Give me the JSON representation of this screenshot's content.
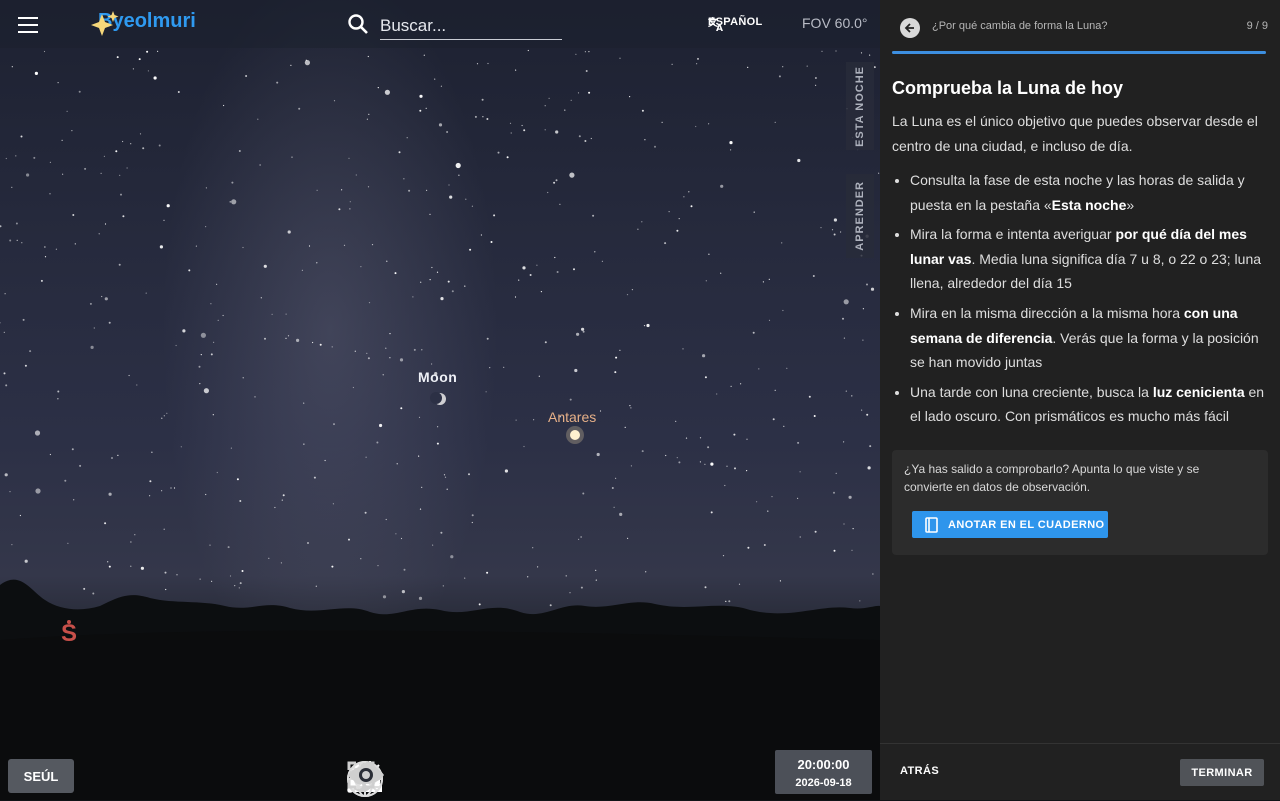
{
  "app": {
    "name": "Byeolmuri"
  },
  "search": {
    "placeholder": "Buscar..."
  },
  "language": {
    "label": "ESPAÑOL"
  },
  "fov": {
    "label": "FOV 60.0°"
  },
  "side_tabs": {
    "tonight": "ESTA NOCHE",
    "learn": "APRENDER"
  },
  "sky": {
    "labels": {
      "moon": "Moon",
      "antares": "Antares"
    },
    "compass": "S"
  },
  "location": {
    "label": "SEÚL"
  },
  "toolbar": {
    "icons": [
      "constellation-lines-icon",
      "constellation-art-icon",
      "atmosphere-icon",
      "landscape-icon",
      "azimuthal-grid-icon",
      "equatorial-grid-icon",
      "deep-sky-objects-icon",
      "night-mode-eye-icon",
      "fullscreen-icon"
    ]
  },
  "datetime": {
    "time": "20:00:00",
    "date": "2026-09-18"
  },
  "panel": {
    "breadcrumb": "¿Por qué cambia de forma la Luna?",
    "step_counter": "9 / 9",
    "progress": 1.0,
    "title": "Comprueba la Luna de hoy",
    "intro": "La Luna es el único objetivo que puedes observar desde el centro de una ciudad, e incluso de día.",
    "bullets": [
      {
        "a": "Consulta la fase de esta noche y las horas de salida y puesta en la pestaña «",
        "b": "Esta noche",
        "c": "»",
        "d": "",
        "e": ""
      },
      {
        "a": "Mira la forma e intenta averiguar ",
        "b": "por qué día del mes lunar vas",
        "c": ". Media luna significa día 7 u 8, o 22 o 23; luna llena, alrededor del día 15",
        "d": "",
        "e": ""
      },
      {
        "a": "Mira en la misma dirección a la misma hora ",
        "b": "con una semana de diferencia",
        "c": ". Verás que la forma y la posición se han movido juntas",
        "d": "",
        "e": ""
      },
      {
        "a": "Una tarde con luna creciente, busca la ",
        "b": "luz cenicienta",
        "c": " en el lado oscuro. Con prismáticos es mucho más fácil",
        "d": "",
        "e": ""
      }
    ],
    "note": {
      "text": "¿Ya has salido a comprobarlo? Apunta lo que viste y se convierte en datos de observación.",
      "button": "ANOTAR EN EL CUADERNO"
    },
    "footer": {
      "prev": "ATRÁS",
      "finish": "TERMINAR"
    }
  },
  "colors": {
    "accent": "#2f9af0",
    "panel_bg": "#212121",
    "moon_label": "#eef0f6",
    "star_label": "#e6b088",
    "compass": "#c8504a"
  }
}
